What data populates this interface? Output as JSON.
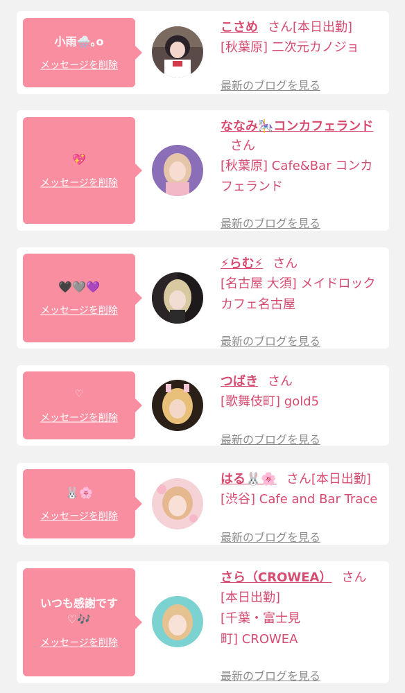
{
  "delete_label": "メッセージを削除",
  "blog_label": "最新のブログを見る",
  "san_label": "さん",
  "colors": {
    "accent_pink": "#f98ea1",
    "text_pink": "#d64b70",
    "link_gray": "#8a8a8a",
    "background": "#f2f2f2"
  },
  "cards": [
    {
      "message": "小雨🌧️｡o",
      "name": "こさめ",
      "status": "[本日出勤]",
      "shop": "[秋葉原] 二次元カノジョ",
      "avatar_icon": "profile-photo"
    },
    {
      "message": "💖",
      "name": "ななみ🎠コンカフェランド",
      "status": "",
      "shop": "[秋葉原] Cafe&Bar コンカフェランド",
      "avatar_icon": "profile-photo"
    },
    {
      "message": "🖤🩶💜",
      "name": "⚡らむ⚡",
      "status": "",
      "shop": "[名古屋 大須] メイドロックカフェ名古屋",
      "avatar_icon": "profile-photo"
    },
    {
      "message": "♡",
      "name": "つばき",
      "status": "",
      "shop": "[歌舞伎町] gold5",
      "avatar_icon": "profile-photo"
    },
    {
      "message": "🐰🌸",
      "name": "はる🐰🌸",
      "status": "[本日出勤]",
      "shop": "[渋谷] Cafe and Bar Trace",
      "avatar_icon": "profile-photo"
    },
    {
      "message": "いつも感謝です\n♡🎶",
      "name": "さら（CROWEA）",
      "status": "[本日出勤]",
      "shop": "[千葉・富士見町] CROWEA",
      "avatar_icon": "profile-photo"
    }
  ]
}
